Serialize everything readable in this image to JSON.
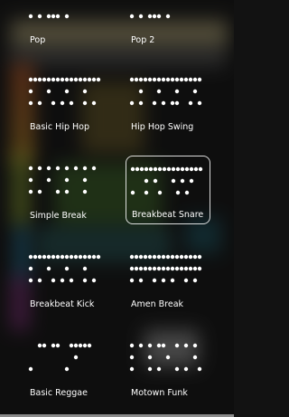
{
  "background": {
    "colors": [
      "#e8d89a",
      "#e0642a",
      "#d8a028",
      "#b7d63a",
      "#6bc23c",
      "#2aa3d8",
      "#b13aa8",
      "#f2f2f2"
    ]
  },
  "selected_pattern": "Breakbeat Snare",
  "patterns": [
    {
      "name": "Pop",
      "selected": false,
      "rows": [
        "x.x.xxx.x......."
      ]
    },
    {
      "name": "Pop 2",
      "selected": false,
      "rows": [
        "x.x.xxx.x......."
      ]
    },
    {
      "name": "Basic Hip Hop",
      "selected": false,
      "rows": [
        "xxxxxxxxxxxxxxxx",
        "x...x...x...x...",
        "x.x..x.x.x..x.x."
      ]
    },
    {
      "name": "Hip Hop Swing",
      "selected": false,
      "rows": [
        "xxxxxxxxxxxxxxxx",
        "..x...x...x...x.",
        "x.x..x.x.xx..x.x"
      ]
    },
    {
      "name": "Simple Break",
      "selected": false,
      "rows": [
        "x.x.x.x.x.x.x.x.",
        "x...x...x...x...",
        "x.x...x.x...x..."
      ]
    },
    {
      "name": "Breakbeat Snare",
      "selected": true,
      "rows": [
        "xxxxxxxxxxxxxxxx",
        "...x.x...x.x.x..",
        "x..x..x...x.x..."
      ]
    },
    {
      "name": "Breakbeat Kick",
      "selected": false,
      "rows": [
        "xxxxxxxxxxxxxxxx",
        "x...x...x...x...",
        "x.x..x.x.x..x.x."
      ]
    },
    {
      "name": "Amen Break",
      "selected": false,
      "rows": [
        "xxxxxxxxxxxxxxxx",
        "xxxxxxxxxxxxxxxx",
        "x.x..x.x.x..x.x."
      ]
    },
    {
      "name": "Basic Reggae",
      "selected": false,
      "rows": [
        "..xx.xx..xxxxx..",
        "..........x.....",
        "x.......x......."
      ]
    },
    {
      "name": "Motown Funk",
      "selected": false,
      "rows": [
        "x.x.x.xx..x.x.x.",
        "x...x...x.....x.",
        "x...x.x...x.x..x"
      ]
    }
  ]
}
